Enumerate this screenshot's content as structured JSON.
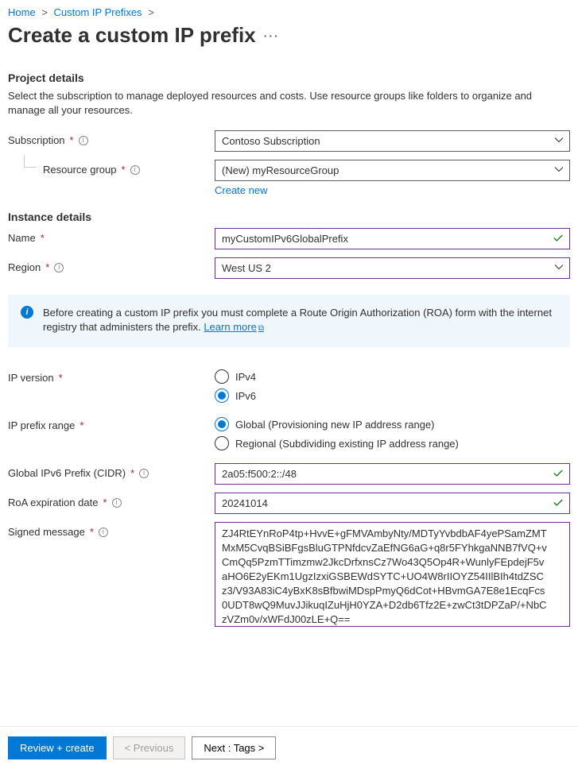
{
  "breadcrumb": {
    "home": "Home",
    "prefixes": "Custom IP Prefixes"
  },
  "title": "Create a custom IP prefix",
  "sections": {
    "project": {
      "heading": "Project details",
      "desc": "Select the subscription to manage deployed resources and costs. Use resource groups like folders to organize and manage all your resources."
    },
    "instance": {
      "heading": "Instance details"
    }
  },
  "fields": {
    "subscription": {
      "label": "Subscription",
      "value": "Contoso Subscription"
    },
    "resourceGroup": {
      "label": "Resource group",
      "value": "(New) myResourceGroup",
      "createNew": "Create new"
    },
    "name": {
      "label": "Name",
      "value": "myCustomIPv6GlobalPrefix"
    },
    "region": {
      "label": "Region",
      "value": "West US 2"
    },
    "ipVersion": {
      "label": "IP version",
      "ipv4": "IPv4",
      "ipv6": "IPv6"
    },
    "ipPrefixRange": {
      "label": "IP prefix range",
      "global": "Global (Provisioning new IP address range)",
      "regional": "Regional (Subdividing existing IP address range)"
    },
    "cidr": {
      "label": "Global IPv6 Prefix (CIDR)",
      "value": "2a05:f500:2::/48"
    },
    "roaExp": {
      "label": "RoA expiration date",
      "value": "20241014"
    },
    "signed": {
      "label": "Signed message",
      "value": "ZJ4RtEYnRoP4tp+HvvE+gFMVAmbyNty/MDTyYvbdbAF4yePSamZMTMxM5CvqBSiBFgsBluGTPNfdcvZaEfNG6aG+q8r5FYhkgaNNB7fVQ+vCmQq5PzmTTimzmw2JkcDrfxnsCz7Wo43Q5Op4R+WunlyFEpdejF5vaHO6E2yEKm1UgzIzxiGSBEWdSYTC+UO4W8rIIOYZ54IIlBIh4tdZSCz3/V93A83iC4yBxK8sBfbwiMDspPmyQ6dCot+HBvmGA7E8e1EcqFcs0UDT8wQ9MuvJJikuqIZuHjH0YZA+D2db6Tfz2E+zwCt3tDPZaP/+NbCzVZm0v/xWFdJ00zLE+Q=="
    }
  },
  "info": {
    "text": "Before creating a custom IP prefix you must complete a Route Origin Authorization (ROA) form with the internet registry that administers the prefix.",
    "linkText": "Learn more"
  },
  "footer": {
    "review": "Review + create",
    "prev": "< Previous",
    "next": "Next : Tags >"
  }
}
